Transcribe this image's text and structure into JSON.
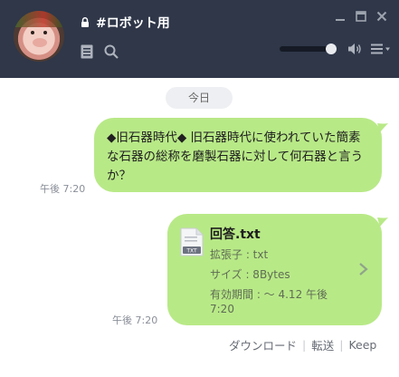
{
  "header": {
    "chat_title": "#ロボット用"
  },
  "chat": {
    "date_label": "今日",
    "messages": [
      {
        "text": "◆旧石器時代◆ 旧石器時代に使われていた簡素な石器の総称を磨製石器に対して何石器と言うか？",
        "time": "午後 7:20"
      }
    ],
    "file_message": {
      "file_name": "回答.txt",
      "extension": "拡張子 : txt",
      "size": "サイズ : 8Bytes",
      "expiry_line1": "有効期間 : ～ 4.12 午後",
      "expiry_line2": "7:20",
      "time": "午後 7:20"
    },
    "actions": {
      "download": "ダウンロード",
      "forward": "転送",
      "keep": "Keep"
    }
  },
  "colors": {
    "header_bg": "#2f3749",
    "bubble_green": "#b8e987"
  },
  "icons": [
    "lock-icon",
    "notes-icon",
    "search-icon",
    "minimize-icon",
    "maximize-icon",
    "close-icon",
    "speaker-icon",
    "menu-icon",
    "txt-file-icon",
    "chevron-right-icon"
  ]
}
